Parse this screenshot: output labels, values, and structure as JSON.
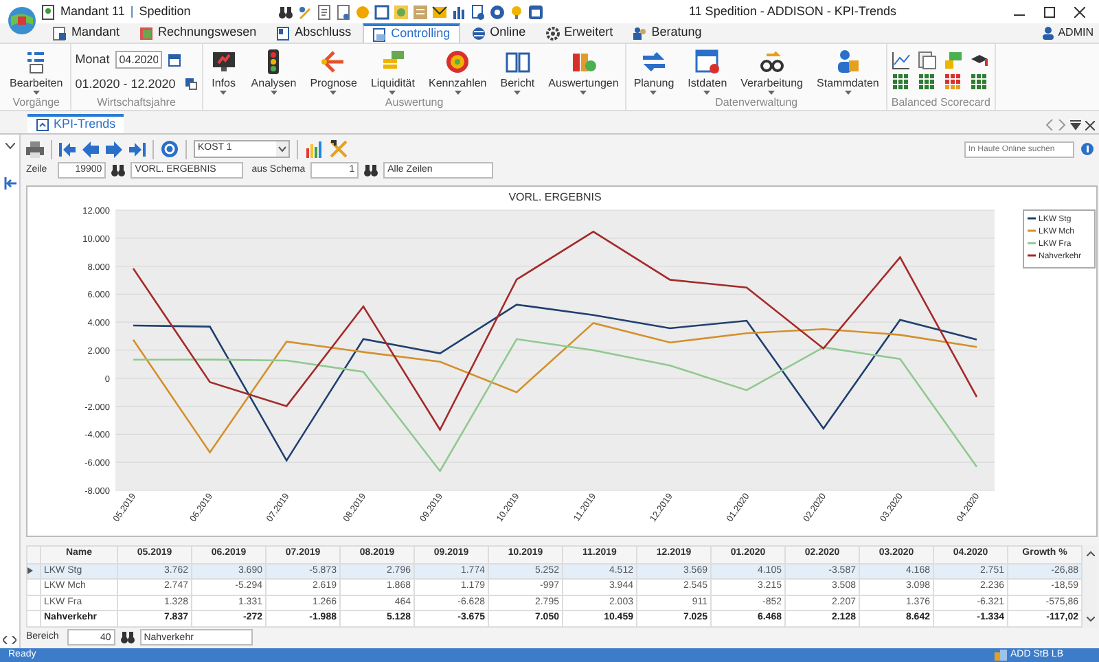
{
  "title_bar": {
    "client": "Mandant 11",
    "separator": "|",
    "company": "Spedition",
    "title": "11 Spedition - ADDISON - KPI-Trends"
  },
  "menu_tabs": [
    {
      "label": "Mandant",
      "selected": false
    },
    {
      "label": "Rechnungswesen",
      "selected": false
    },
    {
      "label": "Abschluss",
      "selected": false
    },
    {
      "label": "Controlling",
      "selected": true
    },
    {
      "label": "Online",
      "selected": false
    },
    {
      "label": "Erweitert",
      "selected": false
    },
    {
      "label": "Beratung",
      "selected": false
    }
  ],
  "user": "ADMIN",
  "ribbon": [
    {
      "kind": "buttons",
      "label": "Vorgänge",
      "buttons": [
        "Bearbeiten"
      ]
    },
    {
      "kind": "fiscal",
      "label": "Wirtschaftsjahre",
      "month_label": "Monat",
      "month_value": "04.2020",
      "range": "01.2020 - 12.2020"
    },
    {
      "kind": "buttons",
      "label": "Auswertung",
      "buttons": [
        "Infos",
        "Analysen",
        "Prognose",
        "Liquidität",
        "Kennzahlen",
        "Bericht",
        "Auswertungen"
      ]
    },
    {
      "kind": "buttons",
      "label": "Datenverwaltung",
      "buttons": [
        "Planung",
        "Istdaten",
        "Verarbeitung",
        "Stammdaten"
      ]
    },
    {
      "kind": "scorecard",
      "label": "Balanced Scorecard"
    }
  ],
  "document_tabs": [
    {
      "label": "KPI-Trends",
      "selected": true
    }
  ],
  "toolbar": {
    "combo": "KOST 1",
    "search_placeholder": "In Haufe Online suchen"
  },
  "filter": {
    "row_label": "Zeile",
    "row_value": "19900",
    "row_name": "VORL. ERGEBNIS",
    "schema_label": "aus Schema",
    "schema_value": "1",
    "rows_value": "Alle Zeilen"
  },
  "chart": {
    "chart_data": {
      "type": "line",
      "title": "VORL. ERGEBNIS",
      "categories": [
        "05.2019",
        "06.2019",
        "07.2019",
        "08.2019",
        "09.2019",
        "10.2019",
        "11.2019",
        "12.2019",
        "01.2020",
        "02.2020",
        "03.2020",
        "04.2020"
      ],
      "series": [
        {
          "name": "LKW Stg",
          "color": "#1f3f6e",
          "values": [
            3762,
            3690,
            -5873,
            2796,
            1774,
            5252,
            4512,
            3569,
            4105,
            -3587,
            4168,
            2751
          ]
        },
        {
          "name": "LKW Mch",
          "color": "#d4902a",
          "values": [
            2747,
            -5294,
            2619,
            1868,
            1179,
            -997,
            3944,
            2545,
            3215,
            3508,
            3098,
            2236
          ]
        },
        {
          "name": "LKW Fra",
          "color": "#8fc98f",
          "values": [
            1328,
            1331,
            1266,
            464,
            -6628,
            2795,
            2003,
            911,
            -852,
            2207,
            1376,
            -6321
          ]
        },
        {
          "name": "Nahverkehr",
          "color": "#a52a2a",
          "values": [
            7837,
            -272,
            -1988,
            5128,
            -3675,
            7050,
            10459,
            7025,
            6468,
            2128,
            8642,
            -1334
          ]
        }
      ],
      "ylim": [
        -8000,
        12000
      ],
      "grid": true,
      "legend": true,
      "yticks": [
        {
          "value": 12000,
          "label": "12.000"
        },
        {
          "value": 10000,
          "label": "10.000"
        },
        {
          "value": 8000,
          "label": "8.000"
        },
        {
          "value": 6000,
          "label": "6.000"
        },
        {
          "value": 4000,
          "label": "4.000"
        },
        {
          "value": 2000,
          "label": "2.000"
        },
        {
          "value": 0,
          "label": "0"
        },
        {
          "value": -2000,
          "label": "-2.000"
        },
        {
          "value": -4000,
          "label": "-4.000"
        },
        {
          "value": -6000,
          "label": "-6.000"
        },
        {
          "value": -8000,
          "label": "-8.000"
        }
      ]
    }
  },
  "table": {
    "columns": [
      "Name",
      "05.2019",
      "06.2019",
      "07.2019",
      "08.2019",
      "09.2019",
      "10.2019",
      "11.2019",
      "12.2019",
      "01.2020",
      "02.2020",
      "03.2020",
      "04.2020",
      "Growth %"
    ],
    "rows": [
      {
        "kind": "detail",
        "selected": true,
        "cells": [
          "LKW Stg",
          "3.762",
          "3.690",
          "-5.873",
          "2.796",
          "1.774",
          "5.252",
          "4.512",
          "3.569",
          "4.105",
          "-3.587",
          "4.168",
          "2.751",
          "-26,88"
        ]
      },
      {
        "kind": "detail",
        "selected": false,
        "cells": [
          "LKW Mch",
          "2.747",
          "-5.294",
          "2.619",
          "1.868",
          "1.179",
          "-997",
          "3.944",
          "2.545",
          "3.215",
          "3.508",
          "3.098",
          "2.236",
          "-18,59"
        ]
      },
      {
        "kind": "detail",
        "selected": false,
        "cells": [
          "LKW Fra",
          "1.328",
          "1.331",
          "1.266",
          "464",
          "-6.628",
          "2.795",
          "2.003",
          "911",
          "-852",
          "2.207",
          "1.376",
          "-6.321",
          "-575,86"
        ]
      },
      {
        "kind": "total",
        "selected": false,
        "cells": [
          "Nahverkehr",
          "7.837",
          "-272",
          "-1.988",
          "5.128",
          "-3.675",
          "7.050",
          "10.459",
          "7.025",
          "6.468",
          "2.128",
          "8.642",
          "-1.334",
          "-117,02"
        ]
      }
    ]
  },
  "area_filter": {
    "label": "Bereich",
    "value": "40",
    "name": "Nahverkehr"
  },
  "status_bar": {
    "text": "Ready",
    "user": "ADD StB LB"
  }
}
